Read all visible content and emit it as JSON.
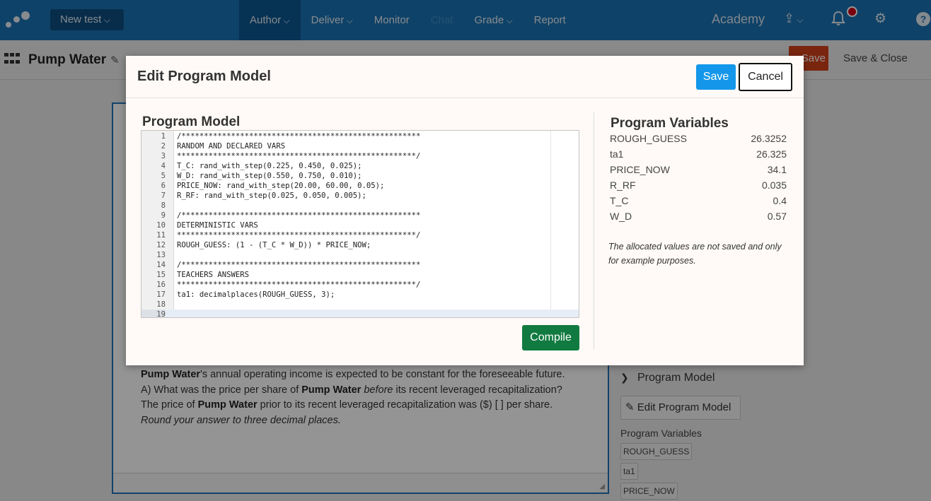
{
  "topnav": {
    "new_test": "New test",
    "items": [
      {
        "label": "Author",
        "dropdown": true,
        "active": true
      },
      {
        "label": "Deliver",
        "dropdown": true
      },
      {
        "label": "Monitor"
      },
      {
        "label": "Chat",
        "disabled": true
      },
      {
        "label": "Grade",
        "dropdown": true
      },
      {
        "label": "Report"
      }
    ],
    "academy": "Academy",
    "icons": [
      "upload-icon",
      "bell-icon",
      "gear-icon",
      "help-icon"
    ]
  },
  "subbar": {
    "title": "Pump Water",
    "save": "Save",
    "save_close": "Save & Close"
  },
  "question": {
    "line1_bold": "Pump Water",
    "line1_rest": "'s annual operating income is expected to be constant for the foreseeable future.",
    "line2_prefix": "A) What was the price per share of ",
    "line2_bold": "Pump Water",
    "line2_em": "before",
    "line2_rest": " its recent leveraged recapitalization?",
    "line3_prefix": "The price of ",
    "line3_bold": "Pump Water",
    "line3_rest": " prior to its recent leveraged recapitalization was ($) [ ] per share.",
    "line4": "Round your answer to three decimal places."
  },
  "right_panel": {
    "program_model": "Program Model",
    "edit_button": "Edit Program Model",
    "variables_label": "Program Variables",
    "tags": [
      "ROUGH_GUESS",
      "ta1",
      "PRICE_NOW"
    ]
  },
  "modal": {
    "title": "Edit Program Model",
    "save": "Save",
    "cancel": "Cancel",
    "program_model_title": "Program Model",
    "compile": "Compile",
    "code_lines": [
      "/*****************************************************",
      "RANDOM AND DECLARED VARS",
      "*****************************************************/",
      "T_C: rand_with_step(0.225, 0.450, 0.025);",
      "W_D: rand_with_step(0.550, 0.750, 0.010);",
      "PRICE_NOW: rand_with_step(20.00, 60.00, 0.05);",
      "R_RF: rand_with_step(0.025, 0.050, 0.005);",
      "",
      "/*****************************************************",
      "DETERMINISTIC VARS",
      "*****************************************************/",
      "ROUGH_GUESS: (1 - (T_C * W_D)) * PRICE_NOW;",
      "",
      "/*****************************************************",
      "TEACHERS ANSWERS",
      "*****************************************************/",
      "ta1: decimalplaces(ROUGH_GUESS, 3);",
      "",
      ""
    ],
    "active_line": 19,
    "variables_title": "Program Variables",
    "variables": [
      {
        "name": "ROUGH_GUESS",
        "value": "26.3252"
      },
      {
        "name": "ta1",
        "value": "26.325"
      },
      {
        "name": "PRICE_NOW",
        "value": "34.1"
      },
      {
        "name": "R_RF",
        "value": "0.035"
      },
      {
        "name": "T_C",
        "value": "0.4"
      },
      {
        "name": "W_D",
        "value": "0.57"
      }
    ],
    "note": "The allocated values are not saved and only for example purposes."
  }
}
